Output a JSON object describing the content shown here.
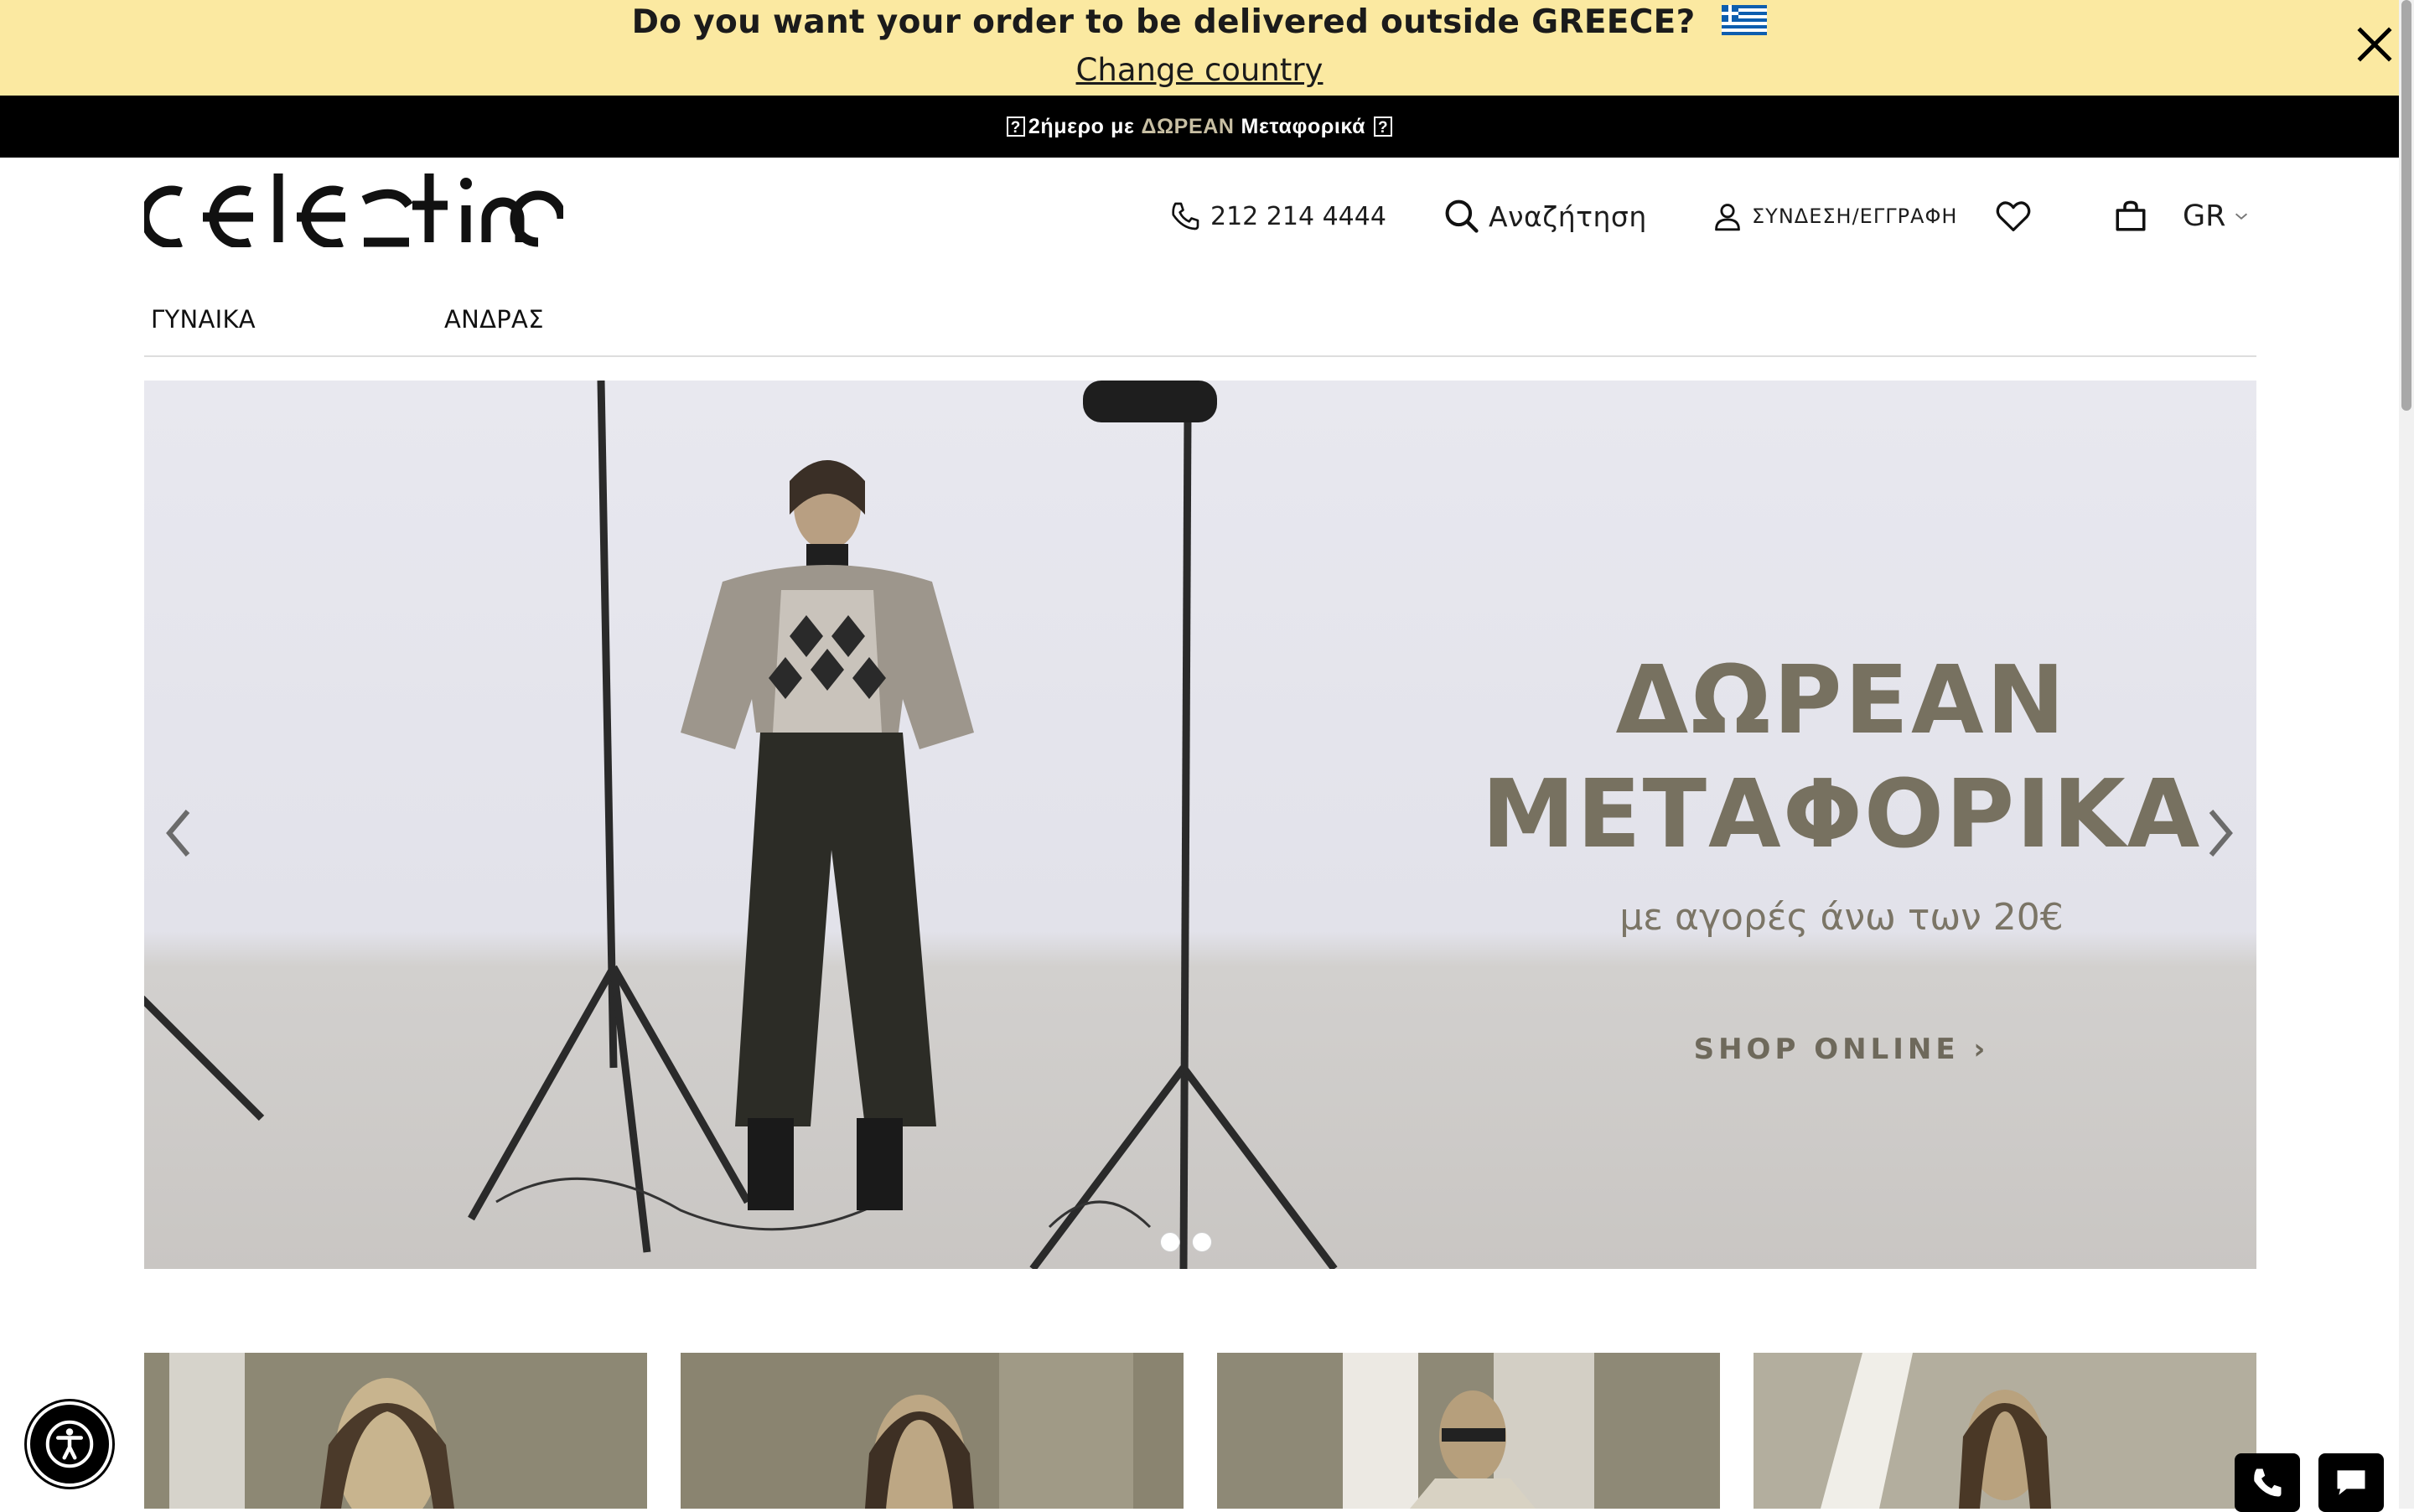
{
  "country_banner": {
    "question": "Do you want your order to be delivered outside GREECE?",
    "change_link": "Change country"
  },
  "promo": {
    "prefix": "2ήμερο με",
    "highlight": "ΔΩΡΕΑΝ",
    "suffix": "Μεταφορικά"
  },
  "header": {
    "logo_text": "celestino",
    "phone": "212 214 4444",
    "search_label": "Αναζήτηση",
    "login_label": "ΣΥΝΔΕΣΗ/ΕΓΓΡΑΦΗ",
    "language": "GR"
  },
  "nav": {
    "items": [
      "ΓΥΝΑΙΚΑ",
      "ΑΝΔΡΑΣ"
    ]
  },
  "hero": {
    "title_line1": "ΔΩΡΕΑΝ",
    "title_line2": "ΜΕΤΑΦΟΡΙΚΑ",
    "subtitle": "με αγορές άνω των 20€",
    "cta": "SHOP ONLINE ›",
    "slides": 2,
    "active_slide": 1
  },
  "colors": {
    "banner": "#fbe9a1",
    "promo_bar": "#000000",
    "hero_text": "#777160",
    "accent": "#c8bfa3"
  }
}
